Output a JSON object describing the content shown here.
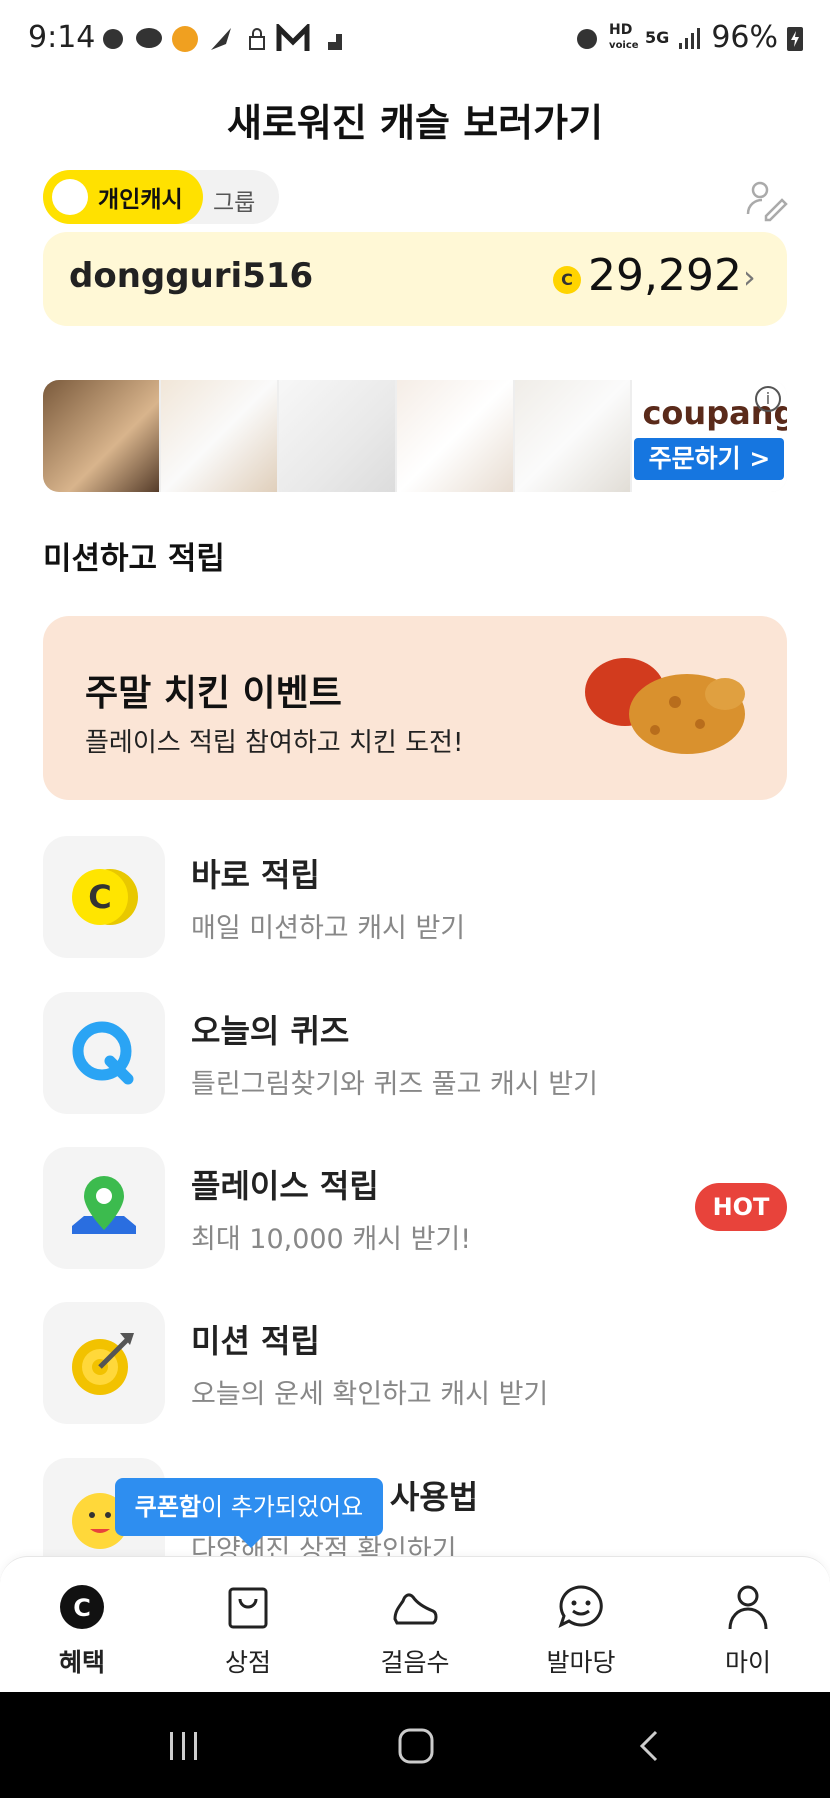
{
  "status": {
    "time": "9:14",
    "battery": "96%",
    "hd": "HD",
    "voice": "voice",
    "net": "5G"
  },
  "header": {
    "title": "새로워진 캐슬 보러가기"
  },
  "toggle": {
    "personal": "개인캐시",
    "group": "그룹"
  },
  "balance": {
    "username": "dongguri516",
    "coin_symbol": "C",
    "amount": "29,292"
  },
  "ad": {
    "brand": "coupang",
    "order_button": "주문하기 >",
    "info": "i"
  },
  "section": {
    "title": "미션하고 적립"
  },
  "promo": {
    "title": "주말 치킨 이벤트",
    "subtitle": "플레이스 적립 참여하고 치킨 도전!"
  },
  "list": [
    {
      "title": "바로 적립",
      "subtitle": "매일 미션하고 캐시 받기",
      "icon": "c-coin-icon"
    },
    {
      "title": "오늘의 퀴즈",
      "subtitle": "틀린그림찾기와 퀴즈 풀고 캐시 받기",
      "icon": "quiz-q-icon"
    },
    {
      "title": "플레이스 적립",
      "subtitle": "최대 10,000 캐시 받기!",
      "icon": "map-pin-icon",
      "badge": "HOT"
    },
    {
      "title": "미션 적립",
      "subtitle": "오늘의 운세 확인하고 캐시 받기",
      "icon": "target-icon"
    },
    {
      "title": "캐시워크 캐시 사용법",
      "subtitle": "다양해진 상점 확인하기",
      "icon": "smile-icon"
    }
  ],
  "toast": {
    "bold": "쿠폰함",
    "rest": "이 추가되었어요"
  },
  "nav": [
    {
      "label": "혜택",
      "icon": "benefit-icon",
      "active": true
    },
    {
      "label": "상점",
      "icon": "shop-bag-icon"
    },
    {
      "label": "걸음수",
      "icon": "shoe-icon"
    },
    {
      "label": "발마당",
      "icon": "chat-smile-icon"
    },
    {
      "label": "마이",
      "icon": "person-icon"
    }
  ],
  "colors": {
    "accent": "#ffe100",
    "card": "#fff8d6",
    "promo": "#fbe5d6",
    "hot": "#e8433b",
    "toast": "#2e8ef0"
  }
}
